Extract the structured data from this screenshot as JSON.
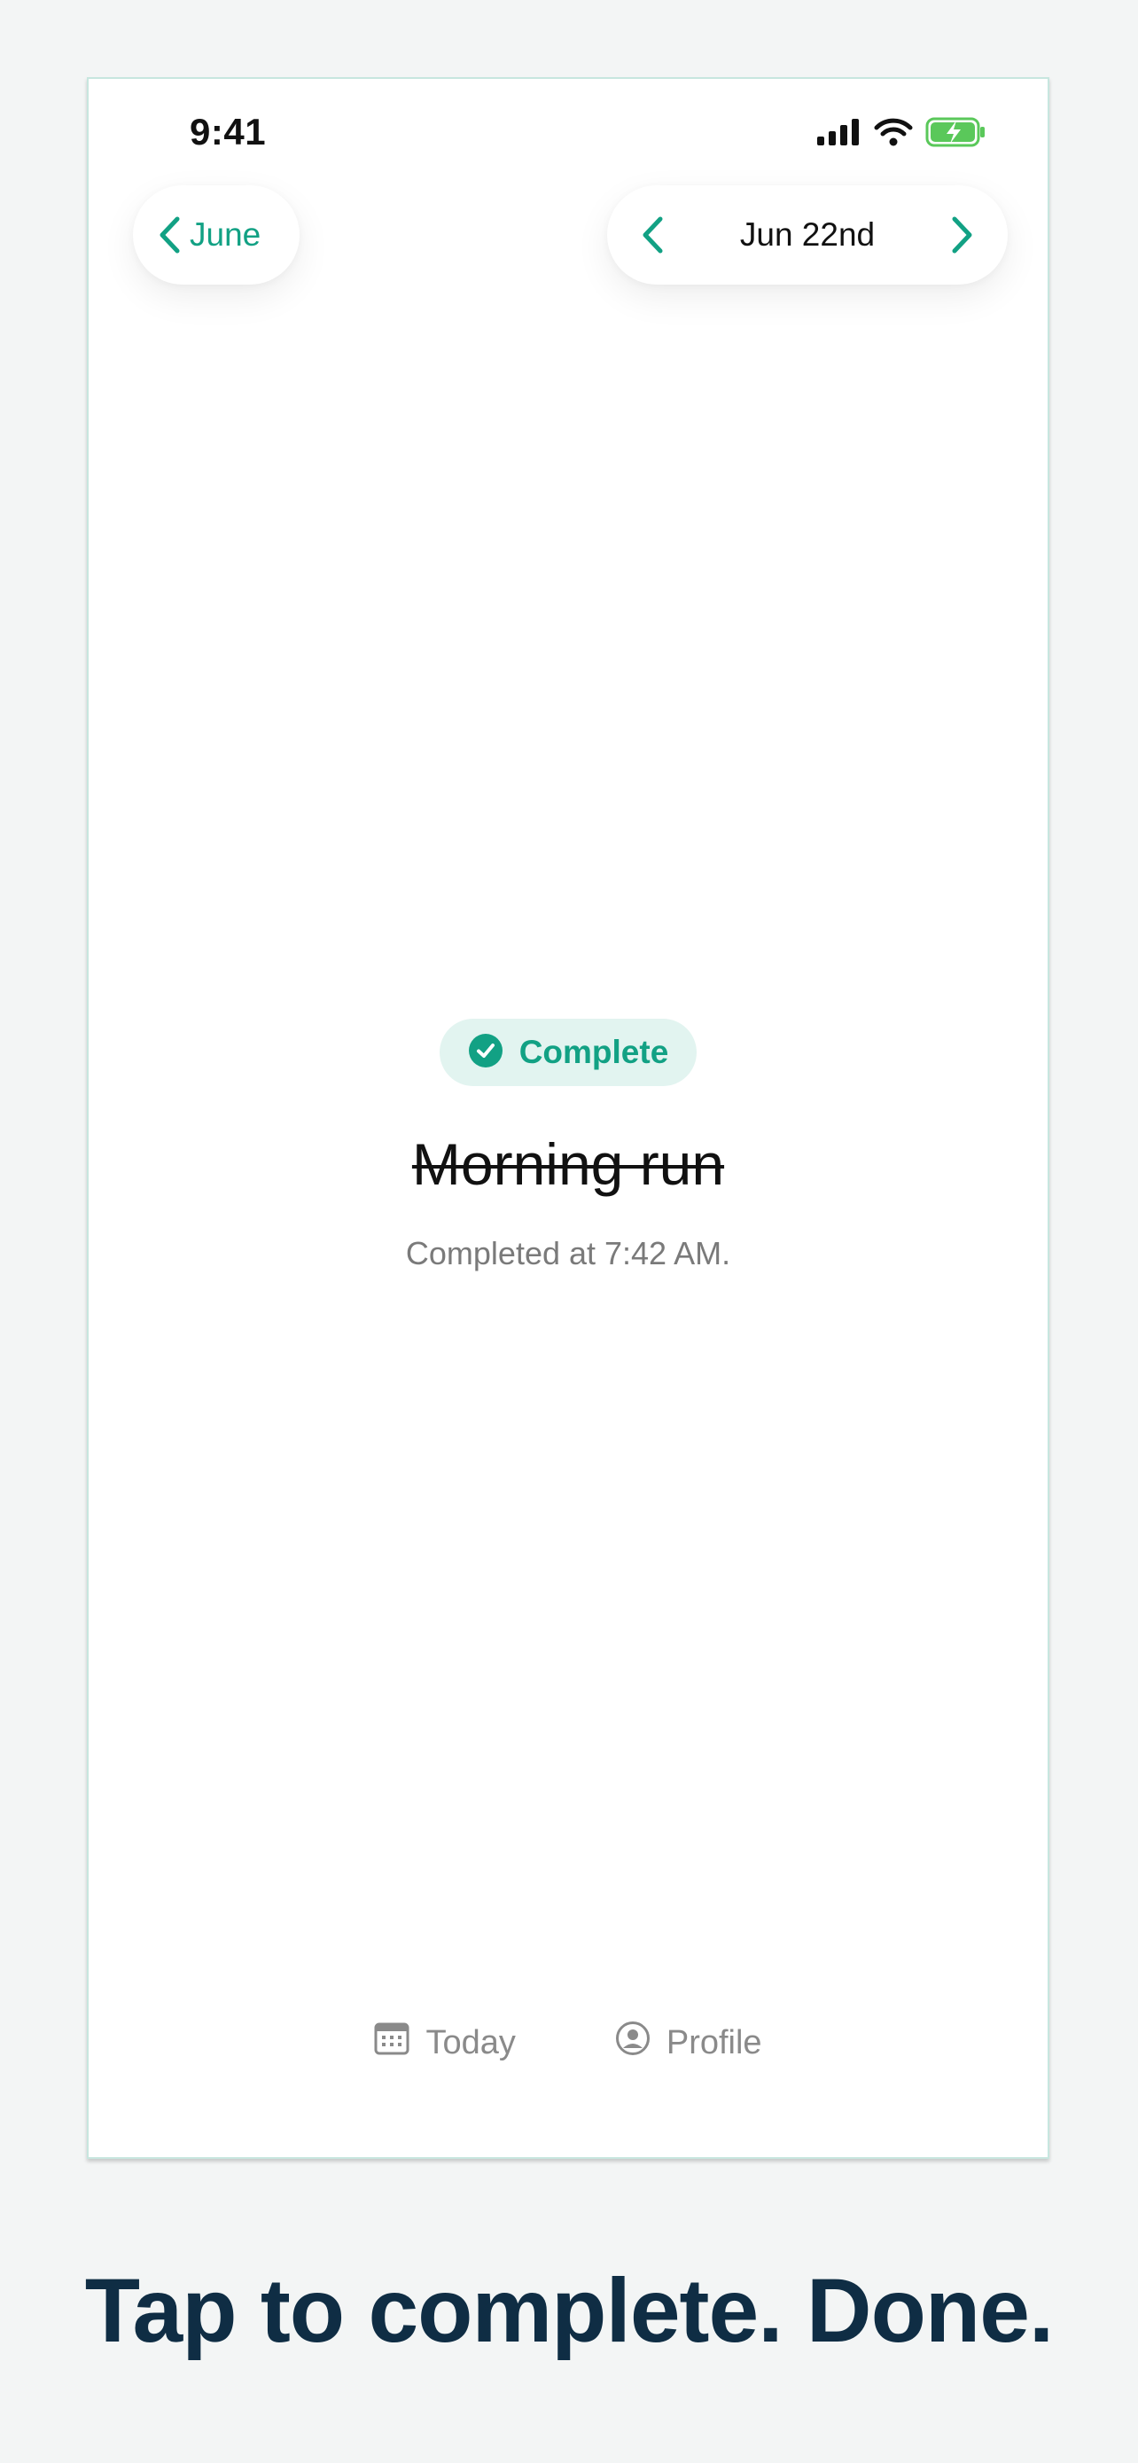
{
  "status_bar": {
    "time": "9:41",
    "icons": [
      "signal-icon",
      "wifi-icon",
      "battery-charging-icon"
    ]
  },
  "nav": {
    "month_label": "June",
    "date_label": "Jun 22nd"
  },
  "task": {
    "status_badge": "Complete",
    "title": "Morning run",
    "completed_text": "Completed at 7:42 AM."
  },
  "tabbar": {
    "items": [
      {
        "label": "Today",
        "icon": "calendar-icon"
      },
      {
        "label": "Profile",
        "icon": "profile-icon"
      }
    ]
  },
  "caption": "Tap to complete. Done.",
  "colors": {
    "accent": "#12a184",
    "badge_bg": "#e2f4f0",
    "caption": "#0f2d44",
    "background": "#f3f5f5"
  }
}
